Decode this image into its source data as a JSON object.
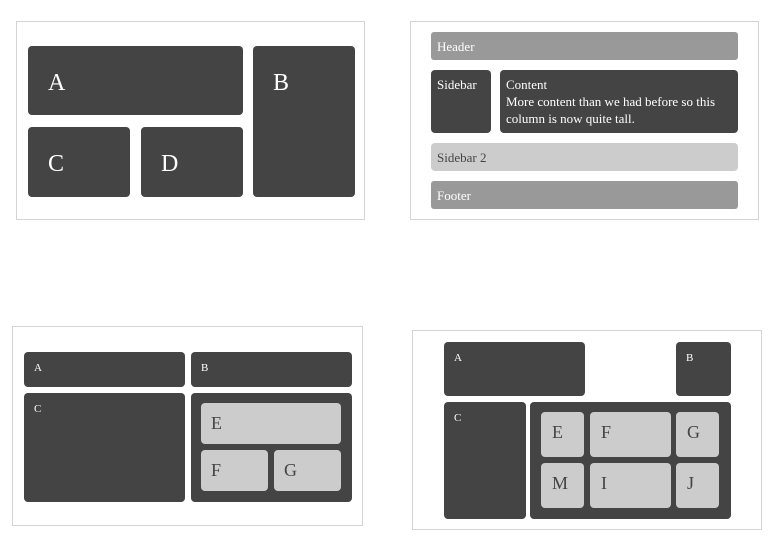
{
  "panel1": {
    "a": "A",
    "b": "B",
    "c": "C",
    "d": "D"
  },
  "panel2": {
    "header": "Header",
    "sidebar": "Sidebar",
    "content_title": "Content",
    "content_body": "More content than we had before so this column is now quite tall.",
    "sidebar2": "Sidebar 2",
    "footer": "Footer"
  },
  "panel3": {
    "a": "A",
    "b": "B",
    "c": "C",
    "e": "E",
    "f": "F",
    "g": "G"
  },
  "panel4": {
    "a": "A",
    "b": "B",
    "c": "C",
    "e": "E",
    "f": "F",
    "g": "G",
    "m": "M",
    "i": "I",
    "j": "J"
  },
  "colors": {
    "dark": "#444444",
    "light": "#cccccc",
    "mid": "#999999",
    "border": "#d4d4d4"
  }
}
